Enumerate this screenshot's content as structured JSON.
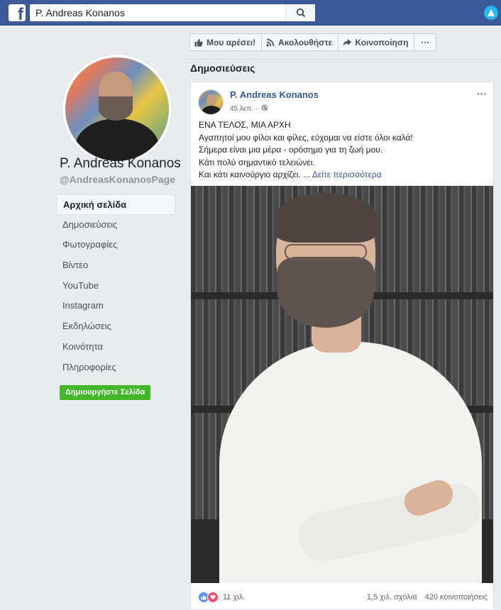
{
  "topbar": {
    "search_value": "P. Andreas Konanos",
    "logo_letter": "f"
  },
  "sidebar": {
    "page_name": "P. Andreas Konanos",
    "page_handle": "@AndreasKonanosPage",
    "nav_items": [
      {
        "label": "Αρχική σελίδα",
        "active": true
      },
      {
        "label": "Δημοσιεύσεις"
      },
      {
        "label": "Φωτογραφίες"
      },
      {
        "label": "Βίντεο"
      },
      {
        "label": "YouTube"
      },
      {
        "label": "Instagram"
      },
      {
        "label": "Εκδηλώσεις"
      },
      {
        "label": "Κοινότητα"
      },
      {
        "label": "Πληροφορίες"
      }
    ],
    "create_page_label": "Δημιουργήστε Σελίδα"
  },
  "actions": {
    "like_label": "Μου αρέσει!",
    "follow_label": "Ακολουθήστε",
    "share_label": "Κοινοποίηση",
    "more_label": "···"
  },
  "section_title": "Δημοσιεύσεις",
  "post": {
    "author": "P. Andreas Konanos",
    "time": "45 λεπ.",
    "lines": [
      "ΕΝΑ ΤΕΛΟΣ, ΜΙΑ ΑΡΧΗ",
      "Αγαπητοί μου φίλοι και φίλες, εύχομαι να είστε όλοι καλά!",
      "Σήμερα είναι μια μέρα - ορόσημο για τη ζωή μου.",
      "Κάτι πολύ σημαντικό τελειώνει.",
      "Και κάτι καινούργιο αρχίζει. ..."
    ],
    "see_more": "Δείτε περισσότερα",
    "more_icon": "···",
    "reactions_count": "11 χιλ.",
    "comments": "1,5 χιλ. σχόλια",
    "shares": "420 κοινοποιήσεις"
  },
  "colors": {
    "brand": "#3b5998",
    "create_button": "#42b72a",
    "link": "#385898"
  }
}
